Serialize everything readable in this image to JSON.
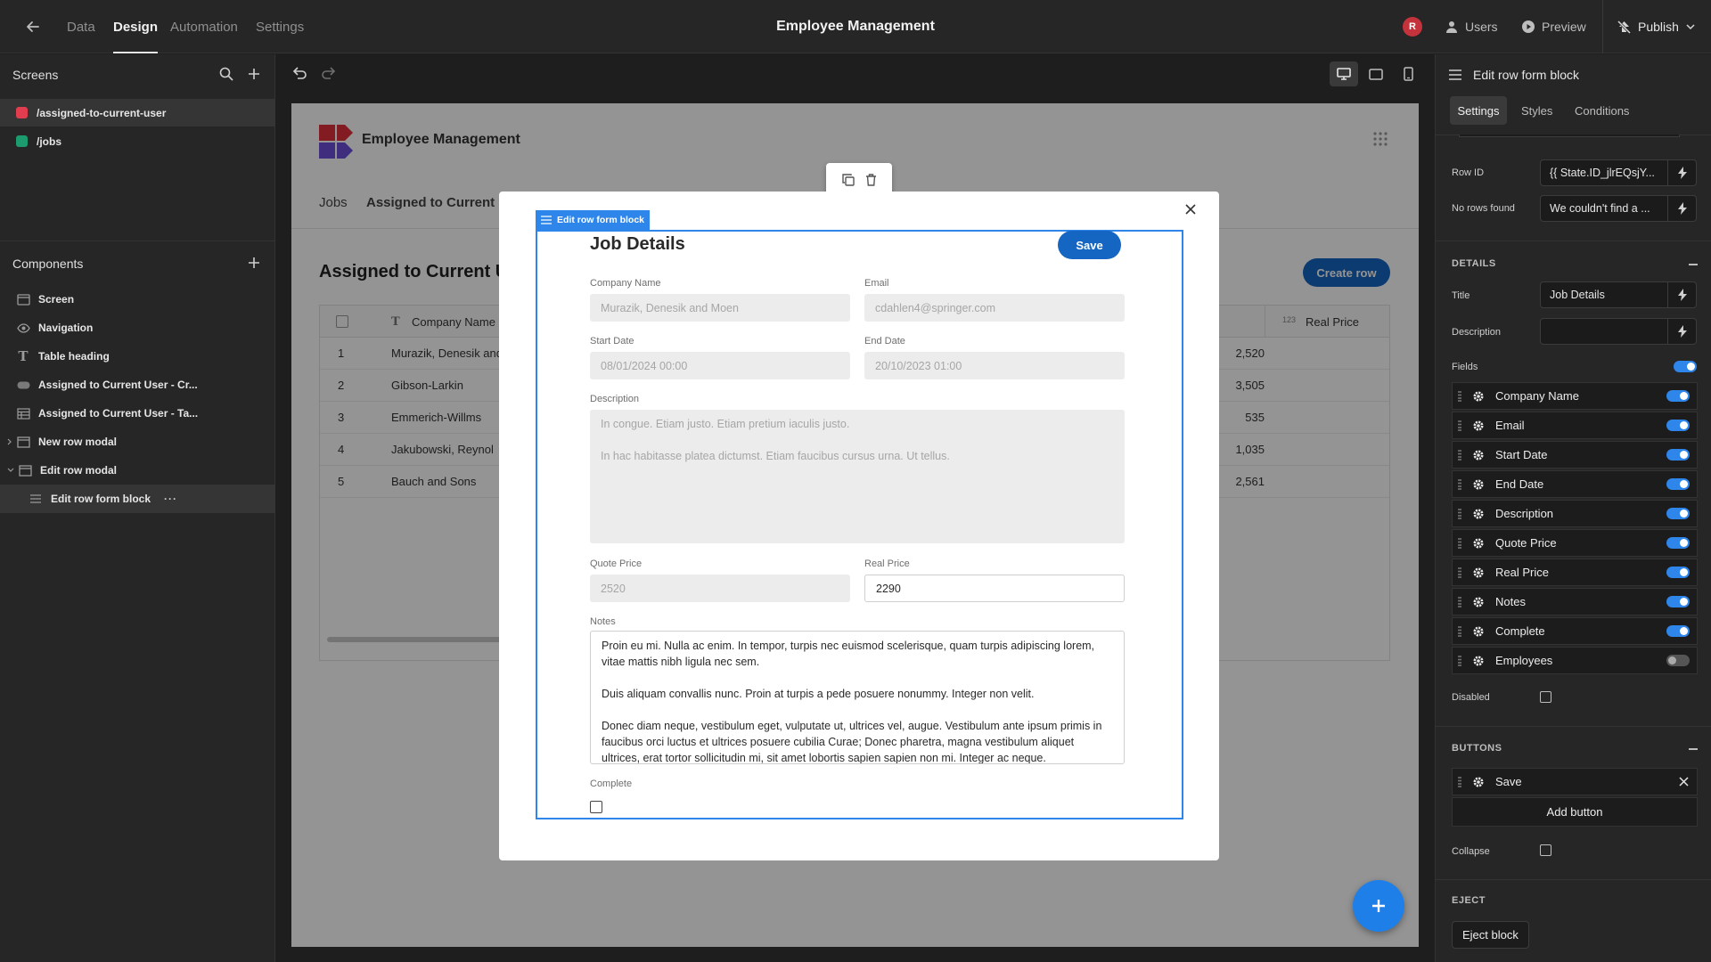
{
  "topbar": {
    "nav": [
      "Data",
      "Design",
      "Automation",
      "Settings"
    ],
    "title": "Employee Management",
    "avatar_initial": "R",
    "users_label": "Users",
    "preview_label": "Preview",
    "publish_label": "Publish"
  },
  "left": {
    "screens_title": "Screens",
    "screens": [
      {
        "label": "/assigned-to-current-user",
        "color": "#e03e4e"
      },
      {
        "label": "/jobs",
        "color": "#1c9b6f"
      }
    ],
    "components_title": "Components",
    "components": [
      {
        "label": "Screen",
        "icon": "screen-icon"
      },
      {
        "label": "Navigation",
        "icon": "eye-icon"
      },
      {
        "label": "Table heading",
        "icon": "text-icon"
      },
      {
        "label": "Assigned to Current User - Cr...",
        "icon": "button-icon"
      },
      {
        "label": "Assigned to Current User - Ta...",
        "icon": "table-icon"
      },
      {
        "label": "New row modal",
        "icon": "modal-icon"
      },
      {
        "label": "Edit row modal",
        "icon": "modal-icon"
      },
      {
        "label": "Edit row form block",
        "icon": "form-icon"
      }
    ]
  },
  "app": {
    "name": "Employee Management",
    "nav_links": [
      "Jobs",
      "Assigned to Current U"
    ],
    "heading": "Assigned to Current U",
    "create_row_label": "Create row",
    "table": {
      "col_company": "Company Name",
      "col_real_price_type": "123",
      "col_real_price": "Real Price",
      "rows": [
        {
          "n": "1",
          "company": "Murazik, Denesik and",
          "price": "2,520"
        },
        {
          "n": "2",
          "company": "Gibson-Larkin",
          "price": "3,505"
        },
        {
          "n": "3",
          "company": "Emmerich-Willms",
          "price": "535"
        },
        {
          "n": "4",
          "company": "Jakubowski, Reynol",
          "price": "1,035"
        },
        {
          "n": "5",
          "company": "Bauch and Sons",
          "price": "2,561"
        }
      ]
    }
  },
  "modal": {
    "block_tag": "Edit row form block",
    "title": "Job Details",
    "save_label": "Save",
    "fields": {
      "company_label": "Company Name",
      "company_value": "Murazik, Denesik and Moen",
      "email_label": "Email",
      "email_value": "cdahlen4@springer.com",
      "start_label": "Start Date",
      "start_value": "08/01/2024 00:00",
      "end_label": "End Date",
      "end_value": "20/10/2023 01:00",
      "desc_label": "Description",
      "desc_p1": "In congue. Etiam justo. Etiam pretium iaculis justo.",
      "desc_p2": "In hac habitasse platea dictumst. Etiam faucibus cursus urna. Ut tellus.",
      "quote_label": "Quote Price",
      "quote_value": "2520",
      "real_label": "Real Price",
      "real_value": "2290",
      "notes_label": "Notes",
      "notes_value": "Proin eu mi. Nulla ac enim. In tempor, turpis nec euismod scelerisque, quam turpis adipiscing lorem, vitae mattis nibh ligula nec sem.\n\nDuis aliquam convallis nunc. Proin at turpis a pede posuere nonummy. Integer non velit.\n\nDonec diam neque, vestibulum eget, vulputate ut, ultrices vel, augue. Vestibulum ante ipsum primis in faucibus orci luctus et ultrices posuere cubilia Curae; Donec pharetra, magna vestibulum aliquet ultrices, erat tortor sollicitudin mi, sit amet lobortis sapien sapien non mi. Integer ac neque.",
      "complete_label": "Complete"
    }
  },
  "right": {
    "header": "Edit row form block",
    "tabs": [
      "Settings",
      "Styles",
      "Conditions"
    ],
    "row_id_label": "Row ID",
    "row_id_value": "{{ State.ID_jlrEQsjY...",
    "no_rows_label": "No rows found",
    "no_rows_value": "We couldn't find a ...",
    "details_section": "DETAILS",
    "title_label": "Title",
    "title_value": "Job Details",
    "description_label": "Description",
    "description_value": "",
    "fields_label": "Fields",
    "fields": [
      {
        "label": "Company Name",
        "on": true
      },
      {
        "label": "Email",
        "on": true
      },
      {
        "label": "Start Date",
        "on": true
      },
      {
        "label": "End Date",
        "on": true
      },
      {
        "label": "Description",
        "on": true
      },
      {
        "label": "Quote Price",
        "on": true
      },
      {
        "label": "Real Price",
        "on": true
      },
      {
        "label": "Notes",
        "on": true
      },
      {
        "label": "Complete",
        "on": true
      },
      {
        "label": "Employees",
        "on": false
      }
    ],
    "disabled_label": "Disabled",
    "buttons_section": "BUTTONS",
    "button_item": "Save",
    "add_button_label": "Add button",
    "collapse_label": "Collapse",
    "eject_section": "EJECT",
    "eject_label": "Eject block"
  },
  "colors": {
    "accent": "#2f86ea",
    "save": "#1466c2",
    "create_row": "#1466c2"
  }
}
